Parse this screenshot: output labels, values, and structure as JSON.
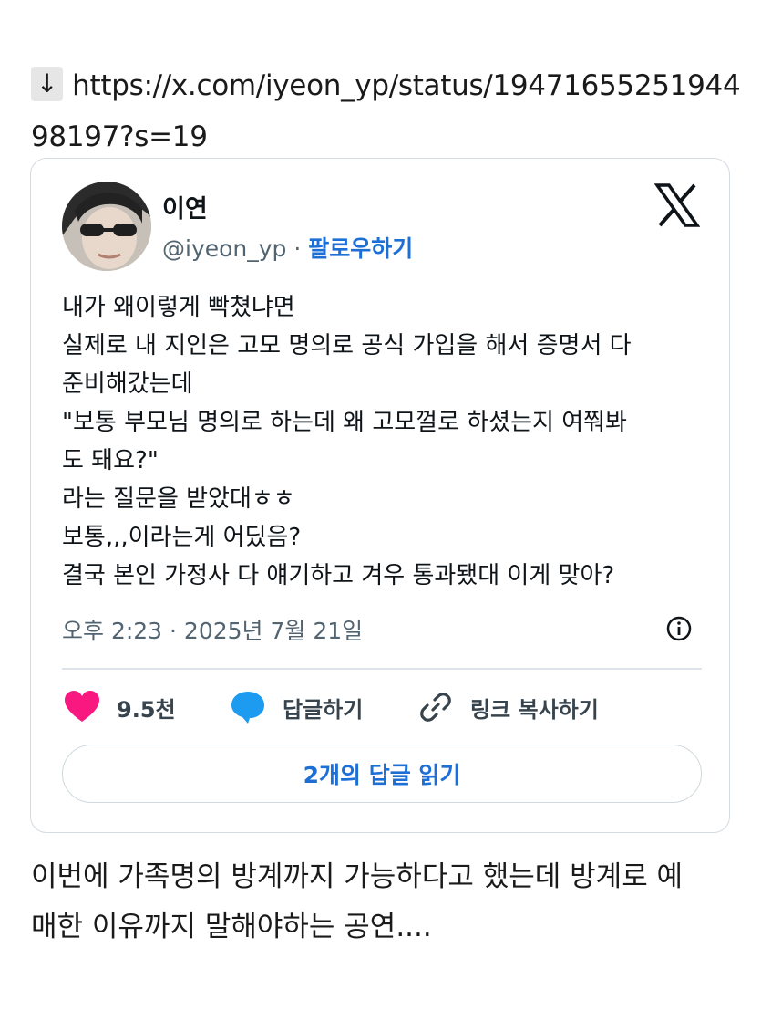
{
  "post_link": {
    "arrow": "↓",
    "url": "https://x.com/iyeon_yp/status/1947165525194498197?s=19"
  },
  "tweet": {
    "author_name": "이연",
    "handle": "@iyeon_yp",
    "separator": " · ",
    "follow_label": "팔로우하기",
    "text": "내가 왜이렇게 빡쳤냐면\n실제로 내 지인은 고모 명의로 공식 가입을 해서 증명서 다\n준비해갔는데\n\"보통 부모님 명의로 하는데 왜 고모껄로 하셨는지 여쭤봐\n도 돼요?\"\n라는 질문을 받았대ㅎㅎ\n보통,,,이라는게 어딨음?\n결국 본인 가정사 다 얘기하고 겨우 통과됐대 이게 맞아?",
    "timestamp": "오후 2:23 · 2025년 7월 21일",
    "likes": "9.5천",
    "reply_label": "답글하기",
    "copy_link_label": "링크 복사하기",
    "read_replies_label": "2개의 답글 읽기"
  },
  "comment": "이번에 가족명의 방계까지 가능하다고 했는데 방계로 예\n매한 이유까지 말해야하는 공연....",
  "icons": {
    "brand": "x-logo-icon",
    "info": "info-icon",
    "like": "heart-icon",
    "reply": "speech-bubble-icon",
    "copy_link": "link-icon"
  },
  "colors": {
    "follow": "#1d6fd6",
    "heart": "#f91880",
    "reply_bubble": "#1d9bf0",
    "muted": "#536471"
  }
}
